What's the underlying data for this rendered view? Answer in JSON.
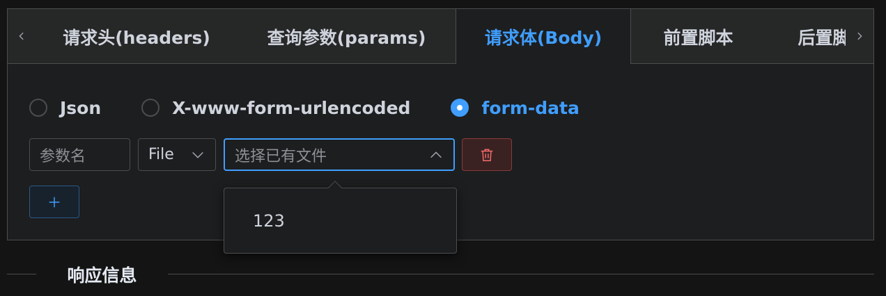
{
  "tabs": [
    {
      "label": "请求头(headers)",
      "active": false
    },
    {
      "label": "查询参数(params)",
      "active": false
    },
    {
      "label": "请求体(Body)",
      "active": true
    },
    {
      "label": "前置脚本",
      "active": false
    },
    {
      "label": "后置脚本",
      "active": false
    }
  ],
  "body_type": {
    "options": [
      {
        "label": "Json",
        "checked": false
      },
      {
        "label": "X-www-form-urlencoded",
        "checked": false
      },
      {
        "label": "form-data",
        "checked": true
      }
    ]
  },
  "form_row": {
    "param_name_placeholder": "参数名",
    "type_value": "File",
    "file_placeholder": "选择已有文件"
  },
  "dropdown": {
    "options": [
      "123"
    ]
  },
  "divider": {
    "label": "响应信息"
  },
  "colors": {
    "accent": "#409eff",
    "danger": "#f56c6c",
    "background": "#141414",
    "panel": "#1d1e1f",
    "border": "#4c4d4f"
  },
  "icons": {
    "tab_prev": "chevron-left-icon",
    "tab_next": "chevron-right-icon",
    "type_select": "chevron-down-icon",
    "file_select": "chevron-up-icon",
    "delete": "trash-icon",
    "add": "plus-icon"
  }
}
